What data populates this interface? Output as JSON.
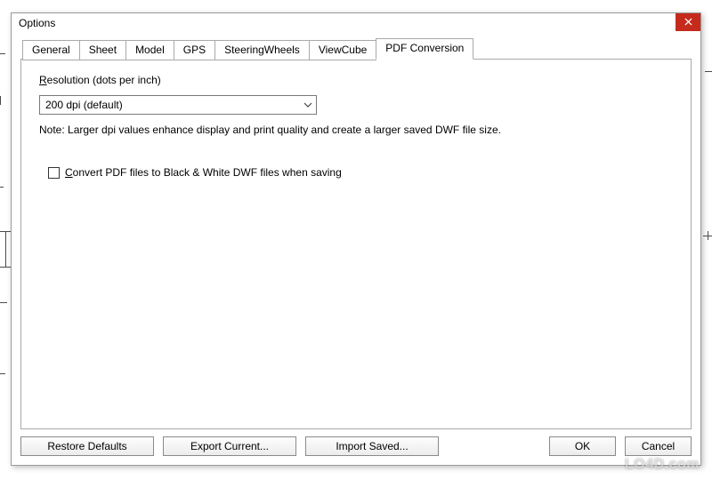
{
  "window": {
    "title": "Options"
  },
  "tabs": [
    {
      "label": "General"
    },
    {
      "label": "Sheet"
    },
    {
      "label": "Model"
    },
    {
      "label": "GPS"
    },
    {
      "label": "SteeringWheels"
    },
    {
      "label": "ViewCube"
    },
    {
      "label": "PDF Conversion"
    }
  ],
  "panel": {
    "resolution_label": "Resolution (dots per inch)",
    "resolution_value": "200 dpi (default)",
    "note": "Note: Larger dpi values enhance display and print quality and create a larger saved DWF file size.",
    "checkbox_label": "Convert PDF files to Black & White DWF files when saving",
    "checkbox_checked": false
  },
  "buttons": {
    "restore": "Restore Defaults",
    "export": "Export Current...",
    "import": "Import Saved...",
    "ok": "OK",
    "cancel": "Cancel"
  },
  "watermark": "LO4D.com"
}
